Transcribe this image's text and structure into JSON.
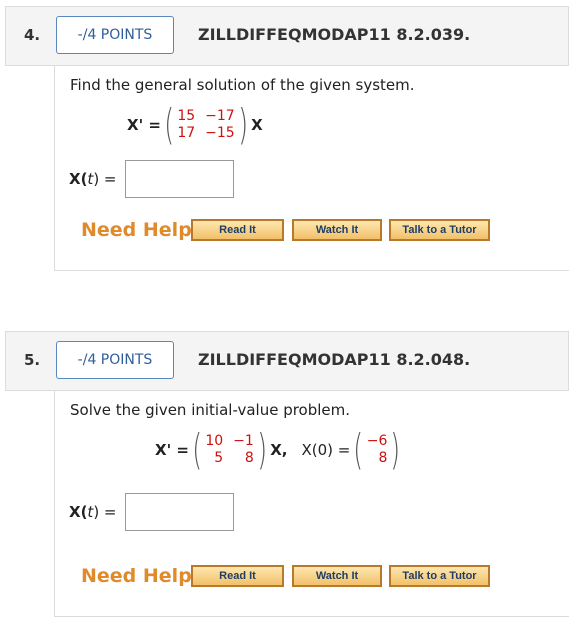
{
  "questions": [
    {
      "number": "4.",
      "points": "-/4 POINTS",
      "id": "ZILLDIFFEQMODAP11 8.2.039.",
      "prompt": "Find the general solution of the given system.",
      "eq_lhs": "X' =",
      "matrix": [
        "15",
        "−17",
        "17",
        "−15"
      ],
      "eq_rhs": "X",
      "answer_label_main": "X(",
      "answer_label_var": "t",
      "answer_label_end": ") =",
      "need_help": "Need Help?",
      "buttons": [
        "Read It",
        "Watch It",
        "Talk to a Tutor"
      ]
    },
    {
      "number": "5.",
      "points": "-/4 POINTS",
      "id": "ZILLDIFFEQMODAP11 8.2.048.",
      "prompt": "Solve the given initial-value problem.",
      "eq_lhs": "X' =",
      "matrix": [
        "10",
        "−1",
        "5",
        "8"
      ],
      "eq_rhs": "X,",
      "ic_lhs": "X(0) =",
      "ic_vector": [
        "−6",
        "8"
      ],
      "answer_label_main": "X(",
      "answer_label_var": "t",
      "answer_label_end": ") =",
      "need_help": "Need Help?",
      "buttons": [
        "Read It",
        "Watch It",
        "Talk to a Tutor"
      ]
    }
  ]
}
